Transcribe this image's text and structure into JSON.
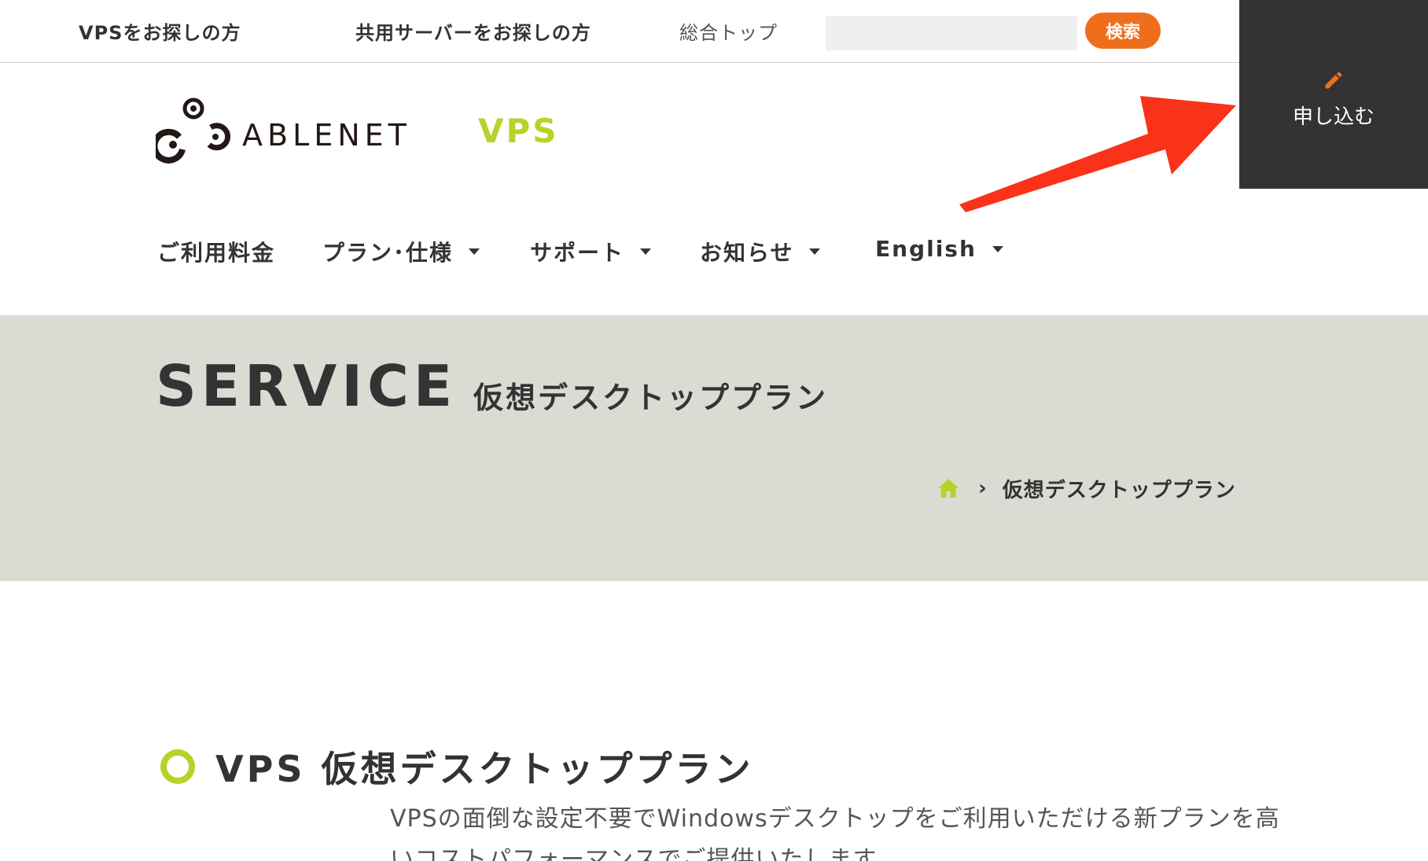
{
  "topbar": {
    "links": [
      "VPSをお探しの方",
      "共用サーバーをお探しの方",
      "総合トップ"
    ],
    "search_placeholder": "",
    "search_button": "検索"
  },
  "apply": {
    "label": "申し込む",
    "icon": "pencil-icon"
  },
  "logo": {
    "wordmark": "ABLENET",
    "product": "VPS"
  },
  "nav": {
    "items": [
      {
        "label": "ご利用料金",
        "dropdown": false
      },
      {
        "label": "プラン･仕様",
        "dropdown": true
      },
      {
        "label": "サポート",
        "dropdown": true
      },
      {
        "label": "お知らせ",
        "dropdown": true
      },
      {
        "label": "English",
        "dropdown": true
      }
    ]
  },
  "hero": {
    "title": "SERVICE",
    "subtitle": "仮想デスクトッププラン",
    "breadcrumb": {
      "home_icon": "home-icon",
      "separator": "›",
      "current": "仮想デスクトッププラン"
    }
  },
  "section": {
    "title": "VPS 仮想デスクトッププラン",
    "description": "VPSの面倒な設定不要でWindowsデスクトップをご利用いただける新プランを高いコストパフォーマンスでご提供いたします。"
  },
  "colors": {
    "accent_green": "#b5d32a",
    "search_orange": "#ef6e1c",
    "apply_dark": "#333333",
    "hero_bg": "#dadbd3",
    "annotation_red": "#fa3219"
  }
}
